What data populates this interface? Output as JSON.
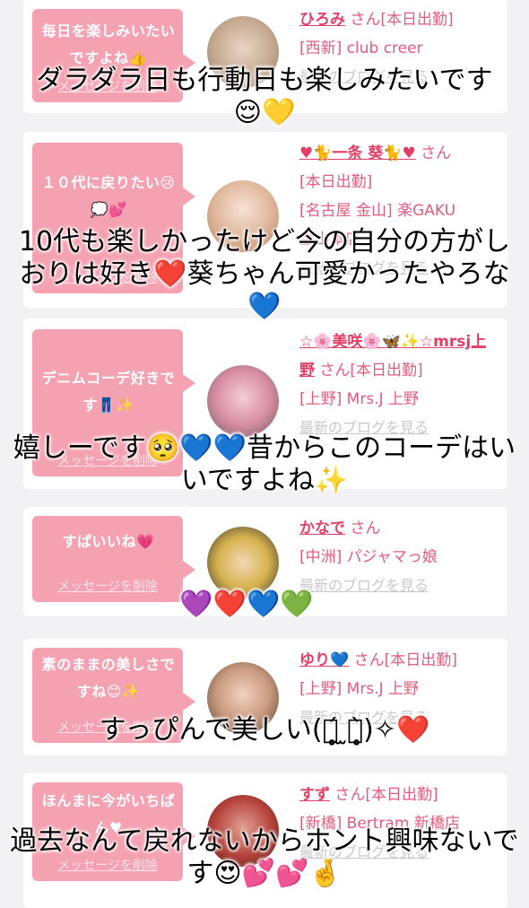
{
  "cards": [
    {
      "message": "毎日を楽しみいたいですよね👍",
      "delete_label": "メッセージを削除",
      "name": "ひろみ",
      "suffix": "さん[本日出勤]",
      "shop": "[西新] club creer",
      "blog_label": "最新のブログを見る"
    },
    {
      "message": "１０代に戻りたい😢💭💕",
      "delete_label": "メッセージを削除",
      "name": "♥🐈一条 葵🐈♥",
      "suffix": "さん",
      "suffix2": "[本日出勤]",
      "shop": "[名古屋 金山] 楽GAKU",
      "shop2": "金山本店",
      "blog_label": "最新のブログを見る"
    },
    {
      "message": "デニムコーデ好きです👖✨",
      "delete_label": "メッセージを削除",
      "name": "☆🌸美咲🌸🦋✨☆mrsj上野",
      "suffix": "さん[本日出勤]",
      "shop": "[上野] Mrs.J 上野",
      "blog_label": "最新のブログを見る"
    },
    {
      "message": "すぱいいね💗",
      "delete_label": "メッセージを削除",
      "name": "かなで",
      "suffix": "さん",
      "shop": "[中洲] パジャマっ娘",
      "blog_label": "最新のブログを見る"
    },
    {
      "message": "素のままの美しさですね😊✨",
      "delete_label": "メッセージを削除",
      "name": "ゆり💙",
      "suffix": "さん[本日出勤]",
      "shop": "[上野] Mrs.J 上野",
      "blog_label": "最新のブログを見る"
    },
    {
      "message": "ほんまに今がいちばん♥",
      "delete_label": "メッセージを削除",
      "name": "すず",
      "suffix": "さん[本日出勤]",
      "shop": "[新橋] Bertram 新橋店",
      "blog_label": "最新のブログを見る"
    }
  ],
  "overlays": [
    "ダラダラ日も行動日も楽しみたいです😌💛",
    "10代も楽しかったけど今の自分の方がしおりは好き❤️葵ちゃん可愛かったやろな💙",
    "嬉しーです🥺💙💙昔からこのコーデはいいですよね✨",
    "💜❤️💙💚",
    "すっぴんで美しい(ཀ̥̥̥́ ̫ཀ̥̥̥̀)✧❤️",
    "過去なんて戻れないからホント興味ないです😍💕💕🤞"
  ],
  "colors": {
    "bubble": "#f4a2b1",
    "name": "#e33e66",
    "shop": "#e25b7c",
    "card": "#ffffff",
    "background": "#f2f2f4"
  }
}
